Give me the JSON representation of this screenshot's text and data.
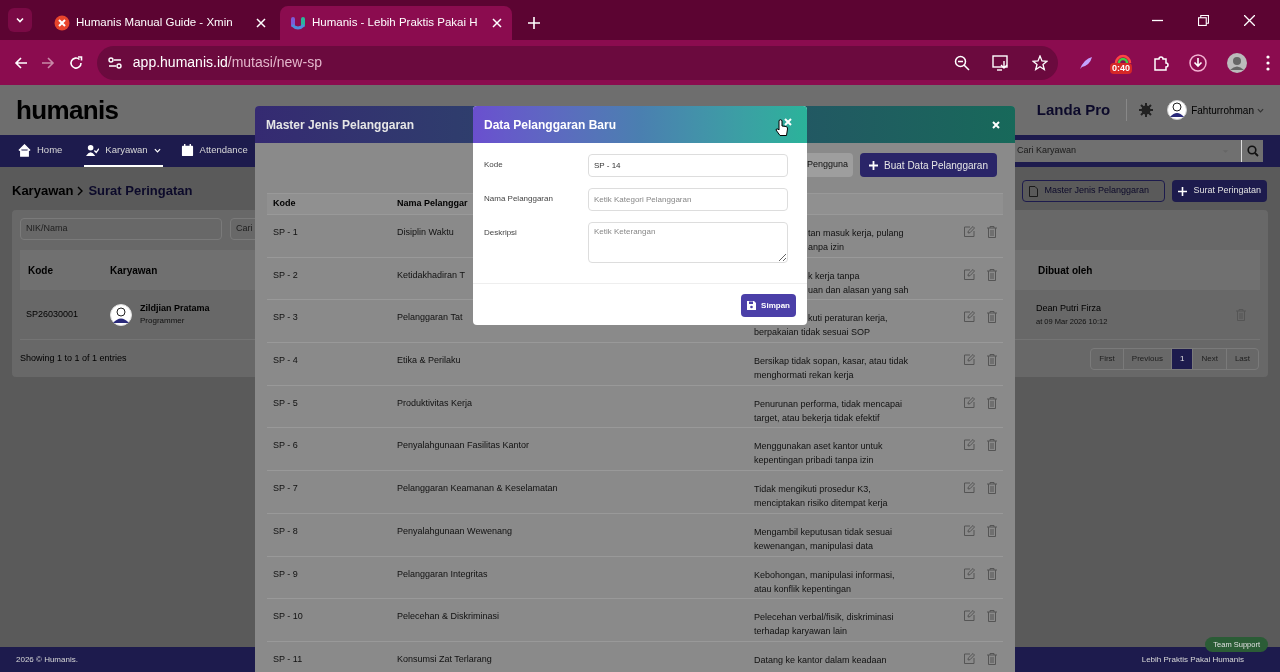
{
  "browser": {
    "tabs": [
      {
        "title": "Humanis Manual Guide - Xmin",
        "selected": false
      },
      {
        "title": "Humanis - Lebih Praktis Pakai H",
        "selected": true
      }
    ],
    "url_host": "app.humanis.id",
    "url_path": "/mutasi/new-sp",
    "extension_badge": "0:40"
  },
  "app": {
    "logo": "humanis",
    "company": "Landa Pro",
    "user": "Fahturrohman",
    "nav": [
      {
        "label": "Home",
        "selected": false
      },
      {
        "label": "Karyawan",
        "selected": true
      },
      {
        "label": "Attendance",
        "selected": false
      }
    ],
    "employee_search": {
      "placeholder": "Cari Karyawan"
    },
    "breadcrumb": [
      "Karyawan",
      "Surat Peringatan"
    ],
    "actions": [
      {
        "label": "Master Jenis Pelanggaran",
        "kind": "outline"
      },
      {
        "label": "Surat Peringatan",
        "kind": "primary"
      }
    ],
    "filter": {
      "placeholder": "NIK/Nama",
      "button": "Cari"
    },
    "table": {
      "columns": [
        "Kode",
        "Karyawan",
        "Dibuat oleh"
      ],
      "rows": [
        {
          "code": "SP26030001",
          "name": "Zildjian Pratama",
          "role": "Programmer",
          "created_by": "Dean Putri Firza",
          "created_at": "at 09 Mar 2026 10:12"
        }
      ]
    },
    "info": "Showing 1 to 1 of 1 entries",
    "pagination": [
      {
        "label": "First",
        "selected": false
      },
      {
        "label": "Previous",
        "selected": false
      },
      {
        "label": "1",
        "selected": true
      },
      {
        "label": "Next",
        "selected": false
      },
      {
        "label": "Last",
        "selected": false
      }
    ],
    "footer": {
      "left": "2026 © Humanis.",
      "right": "Lebih Praktis Pakai Humanis",
      "support": "Team Support"
    }
  },
  "master_modal": {
    "title": "Master Jenis Pelanggaran",
    "buttons": [
      {
        "label": "Pengguna",
        "kind": "secondary"
      },
      {
        "label": "Buat Data Pelanggaran",
        "kind": "primary"
      }
    ],
    "columns": [
      "Kode",
      "Nama Pelanggar"
    ],
    "rows": [
      {
        "code": "SP - 1",
        "name": "Disiplin Waktu",
        "lines_beside_dialog": [
          "tan masuk kerja, pulang",
          "anpa izin"
        ]
      },
      {
        "code": "SP - 2",
        "name": "Ketidakhadiran T",
        "lines_beside_dialog": [
          "k kerja tanpa",
          "uan dan alasan yang sah"
        ]
      },
      {
        "code": "SP - 3",
        "name": "Pelanggaran Tat",
        "lines_beside_dialog": [
          "kuti peraturan kerja,"
        ],
        "lines": [
          "berpakaian tidak sesuai SOP"
        ]
      },
      {
        "code": "SP - 4",
        "name": "Etika & Perilaku",
        "lines": [
          "Bersikap tidak sopan, kasar, atau tidak",
          "menghormati rekan kerja"
        ]
      },
      {
        "code": "SP - 5",
        "name": "Produktivitas Kerja",
        "lines": [
          "Penurunan performa, tidak mencapai",
          "target, atau bekerja tidak efektif"
        ]
      },
      {
        "code": "SP - 6",
        "name": "Penyalahgunaan Fasilitas Kantor",
        "lines": [
          "Menggunakan aset kantor untuk",
          "kepentingan pribadi tanpa izin"
        ]
      },
      {
        "code": "SP - 7",
        "name": "Pelanggaran Keamanan & Keselamatan",
        "lines": [
          "Tidak mengikuti prosedur K3,",
          "menciptakan risiko ditempat kerja"
        ]
      },
      {
        "code": "SP - 8",
        "name": "Penyalahgunaan Wewenang",
        "lines": [
          "Mengambil keputusan tidak sesuai",
          "kewenangan, manipulasi data"
        ]
      },
      {
        "code": "SP - 9",
        "name": "Pelanggaran Integritas",
        "lines": [
          "Kebohongan, manipulasi informasi,",
          "atau konflik kepentingan"
        ]
      },
      {
        "code": "SP - 10",
        "name": "Pelecehan & Diskriminasi",
        "lines": [
          "Pelecehan verbal/fisik, diskriminasi",
          "terhadap karyawan lain"
        ]
      },
      {
        "code": "SP - 11",
        "name": "Konsumsi Zat Terlarang",
        "lines": [
          "Datang ke kantor dalam keadaan"
        ]
      }
    ]
  },
  "data_modal": {
    "title": "Data Pelanggaran Baru",
    "fields": [
      {
        "label": "Kode",
        "kind": "input",
        "value": "SP - 14"
      },
      {
        "label": "Nama Pelanggaran",
        "kind": "input",
        "placeholder": "Ketik Kategori Pelanggaran"
      },
      {
        "label": "Deskripsi",
        "kind": "textarea",
        "placeholder": "Ketik Keterangan"
      }
    ],
    "submit": "Simpan"
  }
}
